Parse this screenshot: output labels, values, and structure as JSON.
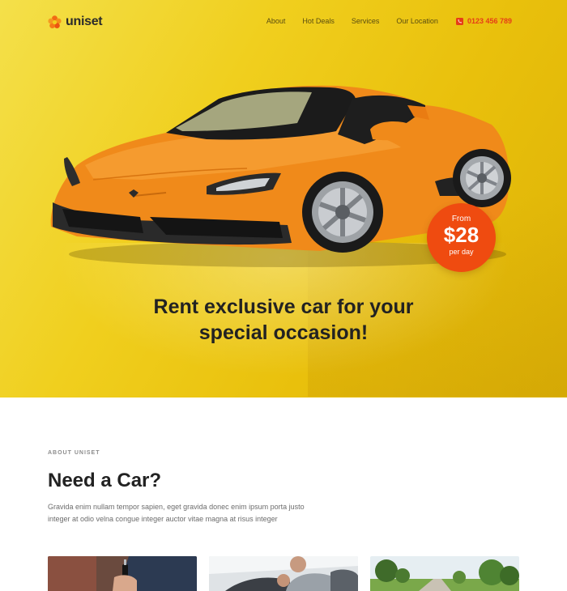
{
  "brand": {
    "name": "uniset"
  },
  "nav": {
    "items": [
      "About",
      "Hot Deals",
      "Services",
      "Our Location"
    ],
    "phone": "0123 456 789"
  },
  "hero": {
    "headline_line1": "Rent exclusive car for your",
    "headline_line2": "special occasion!",
    "badge": {
      "from": "From",
      "price": "$28",
      "per": "per day"
    }
  },
  "about": {
    "eyebrow": "ABOUT UNISET",
    "title": "Need a Car?",
    "text": "Gravida enim nullam tempor sapien, eget gravida donec enim ipsum porta justo integer at odio velna congue integer auctor vitae magna at risus integer"
  },
  "colors": {
    "hero_yellow": "#f0cf1e",
    "accent_orange": "#ef4b10",
    "phone_red": "#e63d17",
    "car_orange": "#f08a1a"
  },
  "icons": [
    "logo-flower-icon",
    "phone-icon"
  ],
  "thumbnails": [
    "car-keys-photo",
    "car-interior-photo",
    "countryside-road-photo"
  ]
}
